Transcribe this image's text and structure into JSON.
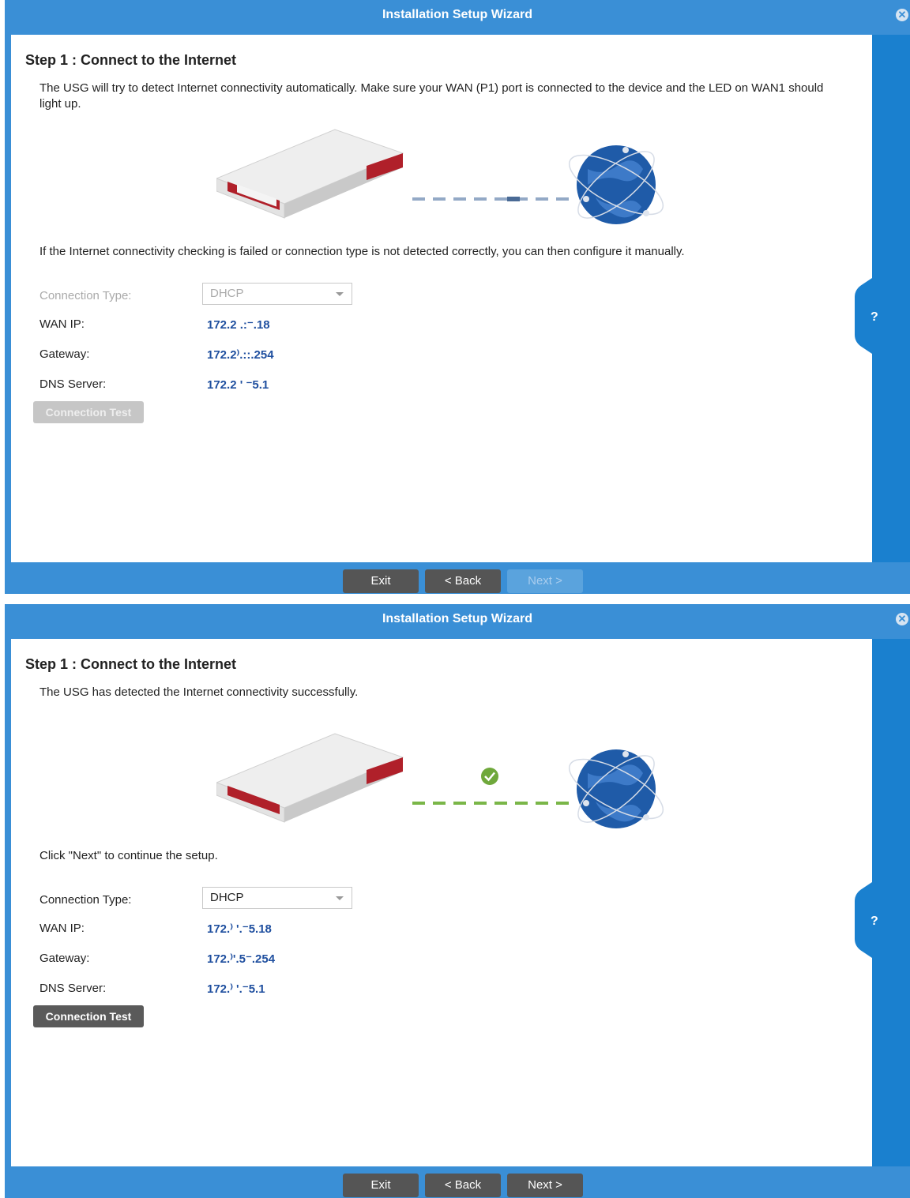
{
  "wizard1": {
    "title": "Installation Setup Wizard",
    "step_title": "Step 1 : Connect to the Internet",
    "description": "The USG will try to detect Internet connectivity automatically. Make sure your WAN (P1) port is connected to the device and the LED on WAN1 should light up.",
    "note": "If the Internet connectivity checking is failed or connection type is not detected correctly, you can then configure it manually.",
    "fields": {
      "connection_type_label": "Connection Type:",
      "connection_type_value": "DHCP",
      "wan_ip_label": "WAN IP:",
      "wan_ip_value": "172.2 .:⁻.18",
      "gateway_label": "Gateway:",
      "gateway_value": "172.2⁾.::.254",
      "dns_label": "DNS Server:",
      "dns_value": "172.2 ' ⁻5.1"
    },
    "connection_test": "Connection Test",
    "help": "?",
    "buttons": {
      "exit": "Exit",
      "back": "< Back",
      "next": "Next >"
    }
  },
  "wizard2": {
    "title": "Installation Setup Wizard",
    "step_title": "Step 1 : Connect to the Internet",
    "description": "The USG has detected the Internet connectivity successfully.",
    "note": "Click \"Next\" to continue the setup.",
    "fields": {
      "connection_type_label": "Connection Type:",
      "connection_type_value": "DHCP",
      "wan_ip_label": "WAN IP:",
      "wan_ip_value": "172.⁾ '.⁻5.18",
      "gateway_label": "Gateway:",
      "gateway_value": "172.⁾'.5⁻.254",
      "dns_label": "DNS Server:",
      "dns_value": "172.⁾ '.⁻5.1"
    },
    "connection_test": "Connection Test",
    "help": "?",
    "buttons": {
      "exit": "Exit",
      "back": "< Back",
      "next": "Next >"
    }
  },
  "colors": {
    "frame": "#3a8fd6",
    "sidebar": "#1a80cf",
    "value_text": "#1f4f9f",
    "success": "#7ab648",
    "dash_pending": "#93a9c6"
  },
  "icons": [
    "close-icon",
    "help-icon",
    "router-device",
    "globe-icon",
    "check-icon"
  ]
}
